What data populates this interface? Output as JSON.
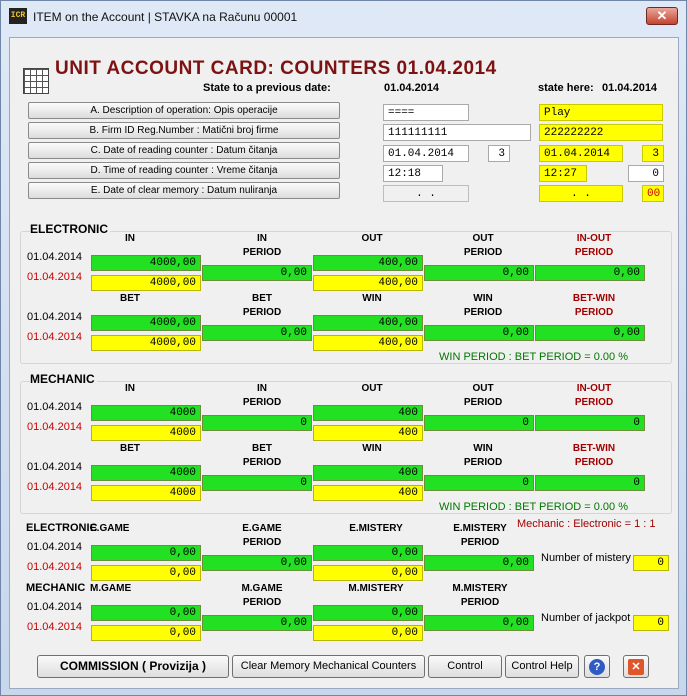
{
  "window": {
    "title": "ITEM on the Account | STAVKA na Računu 00001",
    "icon": "card-reader-icon",
    "app_icon_text": "ICR"
  },
  "header": {
    "title": "UNIT ACCOUNT CARD: COUNTERS 01.04.2014",
    "prev_label": "State to a previous date:",
    "prev_date": "01.04.2014",
    "here_label": "state here:",
    "here_date": "01.04.2014"
  },
  "rows": [
    {
      "label": "A. Description of operation: Opis operacije",
      "prev": "====",
      "here": "Play"
    },
    {
      "label": "B. Firm ID Reg.Number : Matični broj firme",
      "prev": "111111111",
      "here": "222222222"
    },
    {
      "label": "C. Date of reading counter : Datum čitanja",
      "prev": "01.04.2014",
      "prev_n": "3",
      "here": "01.04.2014",
      "here_n": "3"
    },
    {
      "label": "D. Time of reading counter : Vreme čitanja",
      "prev": "12:18",
      "here": "12:27",
      "here_n": "0"
    },
    {
      "label": "E. Date of clear memory : Datum nuliranja",
      "prev": " .  .",
      "here": " .  .",
      "here_n": "00"
    }
  ],
  "electronic": {
    "label": "ELECTRONIC",
    "date_prev": "01.04.2014",
    "date_here": "01.04.2014",
    "h1": [
      "IN",
      "IN\nPERIOD",
      "OUT",
      "OUT\nPERIOD",
      "IN-OUT\nPERIOD"
    ],
    "r1_prev": [
      "4000,00",
      "400,00"
    ],
    "r1_per": [
      "0,00",
      "0,00",
      "0,00"
    ],
    "r1_here": [
      "4000,00",
      "400,00"
    ],
    "h2": [
      "BET",
      "BET\nPERIOD",
      "WIN",
      "WIN\nPERIOD",
      "BET-WIN\nPERIOD"
    ],
    "r2_prev": [
      "4000,00",
      "400,00"
    ],
    "r2_per": [
      "0,00",
      "0,00",
      "0,00"
    ],
    "r2_here": [
      "4000,00",
      "400,00"
    ],
    "ratio": "WIN PERIOD : BET PERIOD =   0.00 %"
  },
  "mechanic": {
    "label": "MECHANIC",
    "date_prev": "01.04.2014",
    "date_here": "01.04.2014",
    "h1": [
      "IN",
      "IN\nPERIOD",
      "OUT",
      "OUT\nPERIOD",
      "IN-OUT\nPERIOD"
    ],
    "r1_prev": [
      "4000",
      "400"
    ],
    "r1_per": [
      "0",
      "0",
      "0"
    ],
    "r1_here": [
      "4000",
      "400"
    ],
    "h2": [
      "BET",
      "BET\nPERIOD",
      "WIN",
      "WIN\nPERIOD",
      "BET-WIN\nPERIOD"
    ],
    "r2_prev": [
      "4000",
      "400"
    ],
    "r2_per": [
      "0",
      "0",
      "0"
    ],
    "r2_here": [
      "4000",
      "400"
    ],
    "ratio": "WIN PERIOD : BET PERIOD =   0.00 %"
  },
  "games": {
    "mech_ratio": "Mechanic : Electronic = 1 : 1",
    "electronic": {
      "label": "ELECTRONIC",
      "date_prev": "01.04.2014",
      "date_here": "01.04.2014",
      "h": [
        "E.GAME",
        "E.GAME\nPERIOD",
        "E.MISTERY",
        "E.MISTERY\nPERIOD"
      ],
      "prev": [
        "0,00",
        "0,00"
      ],
      "per": [
        "0,00",
        "0,00"
      ],
      "here": [
        "0,00",
        "0,00"
      ]
    },
    "mechanic": {
      "label": "MECHANIC",
      "date_prev": "01.04.2014",
      "date_here": "01.04.2014",
      "h": [
        "M.GAME",
        "M.GAME\nPERIOD",
        "M.MISTERY",
        "M.MISTERY\nPERIOD"
      ],
      "prev": [
        "0,00",
        "0,00"
      ],
      "per": [
        "0,00",
        "0,00"
      ],
      "here": [
        "0,00",
        "0,00"
      ]
    },
    "mistery_label": "Number of mistery",
    "mistery_value": "0",
    "jackpot_label": "Number of jackpot",
    "jackpot_value": "0"
  },
  "buttons": {
    "commission": "COMMISSION ( Provizija )",
    "clear_memory": "Clear Memory Mechanical Counters",
    "control": "Control",
    "control_help": "Control Help",
    "help_glyph": "?",
    "exit_glyph": "✕"
  },
  "colors": {
    "title": "#7d1212",
    "green": "#22e022",
    "yellow": "#ffff00",
    "red_date": "#cc0000",
    "ratio": "#007700"
  }
}
